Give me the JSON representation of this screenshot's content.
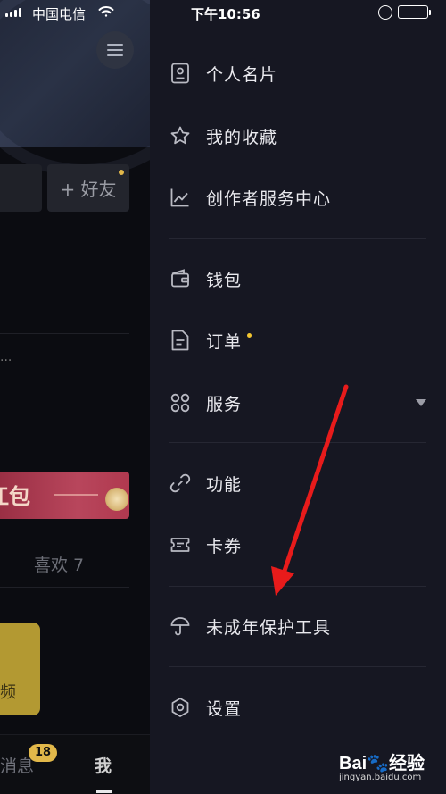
{
  "status_bar": {
    "carrier": "中国电信",
    "time": "下午10:56",
    "battery_color": "#4cd964"
  },
  "background": {
    "add_friend": "+ 好友",
    "ellipsis": "...",
    "red_packet_text": "江包",
    "likes": "喜欢 7",
    "video_card_text": "频",
    "tabs": [
      {
        "label": "消息",
        "badge": "18"
      },
      {
        "label": "我"
      }
    ]
  },
  "drawer": {
    "items": [
      {
        "label": "个人名片",
        "icon": "contact-card-icon"
      },
      {
        "label": "我的收藏",
        "icon": "star-icon"
      },
      {
        "label": "创作者服务中心",
        "icon": "chart-line-icon"
      },
      {
        "label": "钱包",
        "icon": "wallet-icon"
      },
      {
        "label": "订单",
        "icon": "order-document-icon",
        "has_dot": true
      },
      {
        "label": "服务",
        "icon": "services-grid-icon",
        "has_caret": true
      },
      {
        "label": "功能",
        "icon": "link-icon"
      },
      {
        "label": "卡券",
        "icon": "ticket-icon"
      },
      {
        "label": "未成年保护工具",
        "icon": "umbrella-icon"
      },
      {
        "label": "设置",
        "icon": "gear-icon"
      }
    ],
    "accent_dot_color": "#f2c531"
  },
  "annotation": {
    "arrow_color": "#e81b1b"
  },
  "watermark": {
    "brand": "Bai",
    "brand2": "经验",
    "url": "jingyan.baidu.com"
  }
}
